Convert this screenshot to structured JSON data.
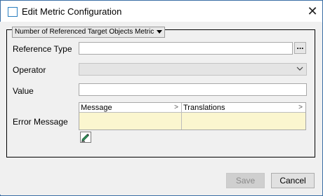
{
  "window": {
    "title": "Edit Metric Configuration"
  },
  "panel": {
    "dropdown_label": "Number of Referenced Target Objects Metric"
  },
  "form": {
    "reference_type_label": "Reference Type",
    "reference_type_value": "",
    "browse_button_label": "...",
    "operator_label": "Operator",
    "operator_value": "",
    "value_label": "Value",
    "value_value": "",
    "error_message_label": "Error Message"
  },
  "grid": {
    "columns": [
      {
        "label": "Message"
      },
      {
        "label": "Translations"
      }
    ],
    "highlight_color": "#fbf6cf"
  },
  "buttons": {
    "save": "Save",
    "cancel": "Cancel"
  },
  "icons": {
    "title": "window-icon",
    "close": "close-icon",
    "edit": "edit-pencil-icon"
  }
}
